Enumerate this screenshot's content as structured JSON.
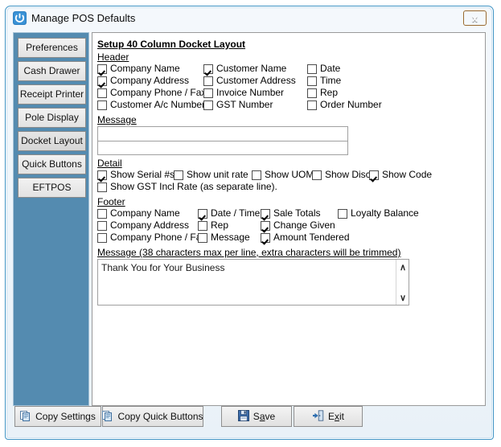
{
  "window": {
    "title": "Manage POS Defaults",
    "icon": "power-icon",
    "close_label": "x",
    "accent_blue": "#3f93c4",
    "sidebar_blue": "#548bb0",
    "close_orange": "#cd8b3a"
  },
  "sidebar": {
    "items": [
      {
        "label": "Preferences",
        "selected": false
      },
      {
        "label": "Cash Drawer",
        "selected": false
      },
      {
        "label": "Receipt Printer",
        "selected": false
      },
      {
        "label": "Pole Display",
        "selected": false
      },
      {
        "label": "Docket Layout",
        "selected": true
      },
      {
        "label": "Quick Buttons",
        "selected": false
      },
      {
        "label": "EFTPOS",
        "selected": false
      }
    ]
  },
  "content": {
    "title": "Setup 40 Column Docket Layout",
    "header": {
      "heading": "Header",
      "col1": [
        {
          "label": "Company Name",
          "checked": true
        },
        {
          "label": "Company Address",
          "checked": true
        },
        {
          "label": "Company Phone / Fax",
          "checked": false
        },
        {
          "label": "Customer A/c Number",
          "checked": false
        }
      ],
      "col2": [
        {
          "label": "Customer Name",
          "checked": true
        },
        {
          "label": "Customer Address",
          "checked": false
        },
        {
          "label": "Invoice Number",
          "checked": false
        },
        {
          "label": "GST Number",
          "checked": false
        }
      ],
      "col3": [
        {
          "label": "Date",
          "checked": false
        },
        {
          "label": "Time",
          "checked": false
        },
        {
          "label": "Rep",
          "checked": false
        },
        {
          "label": "Order Number",
          "checked": false
        }
      ]
    },
    "message": {
      "heading": "Message",
      "line1": "",
      "line2": ""
    },
    "detail": {
      "heading": "Detail",
      "row1": [
        {
          "label": "Show Serial #s",
          "checked": true
        },
        {
          "label": "Show unit rate",
          "checked": false
        },
        {
          "label": "Show UOM",
          "checked": false
        },
        {
          "label": "Show Disc",
          "checked": false
        },
        {
          "label": "Show Code",
          "checked": true
        }
      ],
      "row2": [
        {
          "label": "Show GST Incl Rate (as separate line).",
          "checked": false
        }
      ]
    },
    "footer": {
      "heading": "Footer",
      "col1": [
        {
          "label": "Company Name",
          "checked": false
        },
        {
          "label": "Company Address",
          "checked": false
        },
        {
          "label": "Company Phone / Fax",
          "checked": false
        }
      ],
      "col2": [
        {
          "label": "Date / Time",
          "checked": true
        },
        {
          "label": "Rep",
          "checked": false
        },
        {
          "label": "Message",
          "checked": false
        }
      ],
      "col3": [
        {
          "label": "Sale Totals",
          "checked": true
        },
        {
          "label": "Change Given",
          "checked": true
        },
        {
          "label": "Amount Tendered",
          "checked": true
        }
      ],
      "col4": [
        {
          "label": "Loyalty Balance",
          "checked": false
        }
      ]
    },
    "footer_message": {
      "heading": "Message (38 characters max per line, extra characters will be trimmed)",
      "value": "Thank You for Your Business",
      "scroll_up": "∧",
      "scroll_down": "∨"
    }
  },
  "buttons": {
    "copy_settings": {
      "label": "Copy Settings",
      "icon": "copy-icon"
    },
    "copy_quick_buttons": {
      "label": "Copy Quick Buttons",
      "icon": "copy-icon"
    },
    "save": {
      "prefix": "S",
      "accel": "a",
      "suffix": "ve",
      "icon": "save-floppy-icon"
    },
    "exit": {
      "prefix": "E",
      "accel": "x",
      "suffix": "it",
      "icon": "exit-door-icon"
    }
  }
}
